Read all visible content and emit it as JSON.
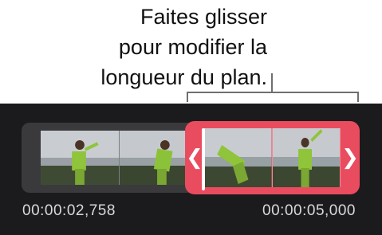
{
  "callout": {
    "line1": "Faites glisser",
    "line2": "pour modifier la",
    "line3": "longueur du plan."
  },
  "timeline": {
    "start_timecode": "00:00:02,758",
    "end_timecode": "00:00:05,000",
    "left_trim_glyph": "❮",
    "right_trim_glyph": "❯",
    "selection_color": "#ea4c5f"
  },
  "icons": {
    "left_trim": "chevron-left-icon",
    "right_trim": "chevron-right-icon"
  }
}
